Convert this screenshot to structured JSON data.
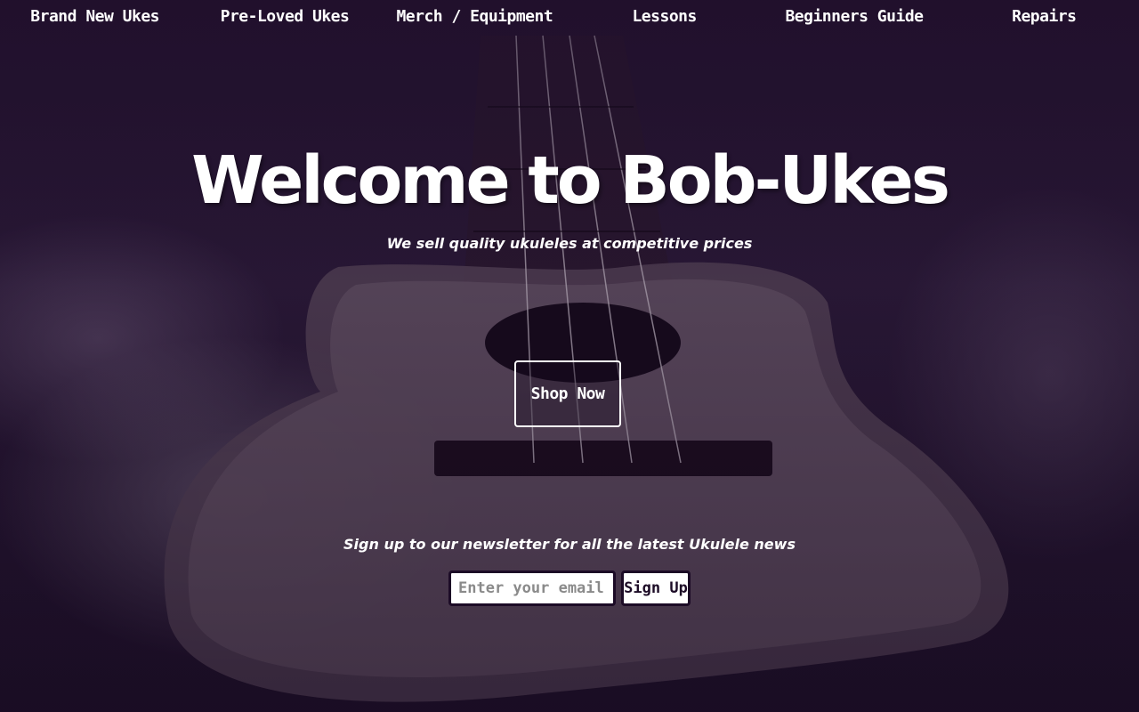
{
  "nav": {
    "items": [
      {
        "label": "Brand New Ukes"
      },
      {
        "label": "Pre-Loved Ukes"
      },
      {
        "label": "Merch / Equipment"
      },
      {
        "label": "Lessons"
      },
      {
        "label": "Beginners Guide"
      },
      {
        "label": "Repairs"
      }
    ]
  },
  "hero": {
    "title": "Welcome to Bob-Ukes",
    "tagline": "We sell quality ukuleles at competitive prices",
    "cta_label": "Shop Now"
  },
  "newsletter": {
    "text": "Sign up to our newsletter for all the latest Ukulele news",
    "email_placeholder": "Enter your email",
    "email_value": "",
    "button_label": "Sign Up"
  },
  "colors": {
    "overlay": "#1e0c2a",
    "text": "#ffffff",
    "input_border": "#1c0b26"
  }
}
